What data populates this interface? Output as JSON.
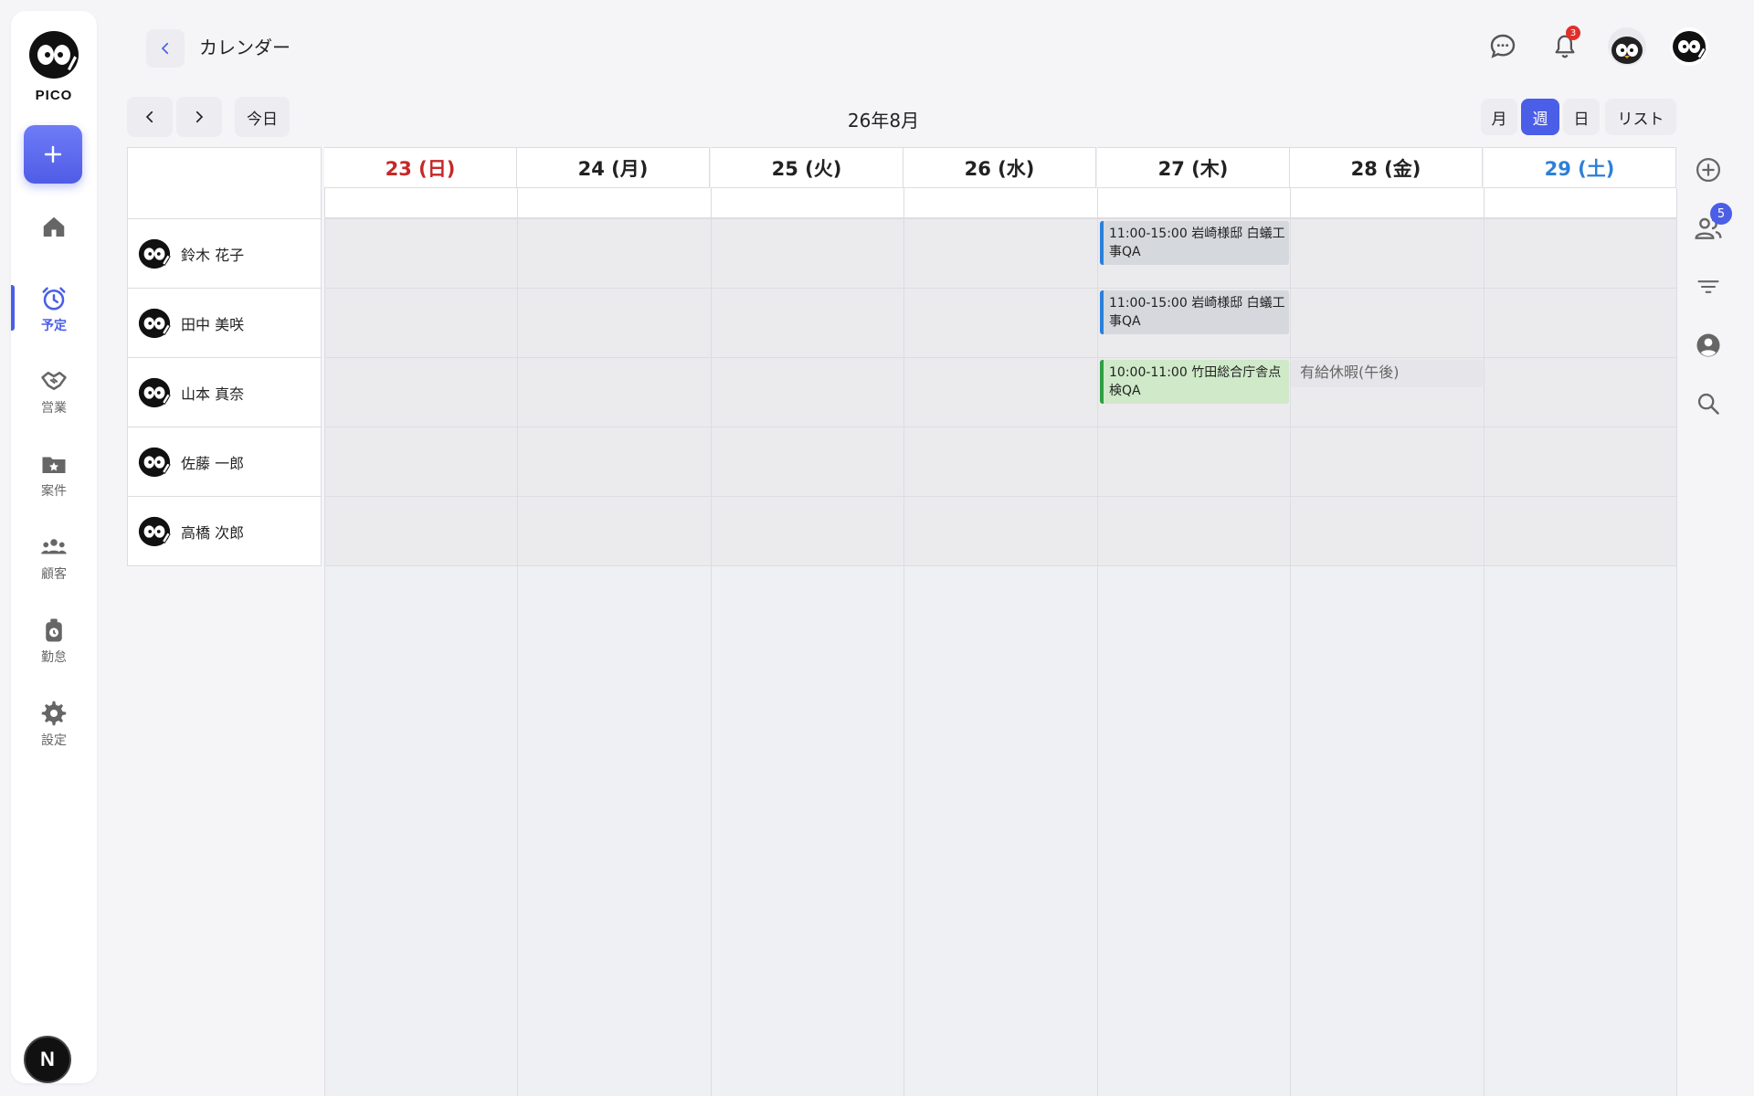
{
  "app": {
    "logo_text": "PICO"
  },
  "header": {
    "title": "カレンダー",
    "notification_count": "3"
  },
  "sidebar": {
    "items": [
      {
        "id": "home",
        "label": "",
        "icon": "home-icon"
      },
      {
        "id": "schedule",
        "label": "予定",
        "icon": "alarm-clock-icon",
        "active": true
      },
      {
        "id": "sales",
        "label": "営業",
        "icon": "handshake-icon"
      },
      {
        "id": "projects",
        "label": "案件",
        "icon": "folder-star-icon"
      },
      {
        "id": "customers",
        "label": "顧客",
        "icon": "group-icon"
      },
      {
        "id": "attendance",
        "label": "勤怠",
        "icon": "badge-clock-icon"
      },
      {
        "id": "settings",
        "label": "設定",
        "icon": "gear-icon"
      }
    ],
    "bottom_badge": "N"
  },
  "toolbar": {
    "today_label": "今日",
    "month_label": "26年8月",
    "views": [
      {
        "id": "month",
        "label": "月"
      },
      {
        "id": "week",
        "label": "週",
        "active": true
      },
      {
        "id": "day",
        "label": "日"
      },
      {
        "id": "list",
        "label": "リスト"
      }
    ]
  },
  "right_rail": {
    "people_badge": "5"
  },
  "calendar": {
    "days": [
      {
        "label": "23 (日)",
        "kind": "sun"
      },
      {
        "label": "24 (月)",
        "kind": "weekday"
      },
      {
        "label": "25 (火)",
        "kind": "weekday"
      },
      {
        "label": "26 (水)",
        "kind": "weekday"
      },
      {
        "label": "27 (木)",
        "kind": "weekday"
      },
      {
        "label": "28 (金)",
        "kind": "weekday"
      },
      {
        "label": "29 (土)",
        "kind": "sat"
      }
    ],
    "people": [
      {
        "name": "鈴木 花子"
      },
      {
        "name": "田中 美咲"
      },
      {
        "name": "山本 真奈"
      },
      {
        "name": "佐藤 一郎"
      },
      {
        "name": "高橋 次郎"
      }
    ],
    "events": [
      {
        "person": 0,
        "day": 4,
        "text": "11:00-15:00 岩崎様邸 白蟻工事QA",
        "color": "blue"
      },
      {
        "person": 1,
        "day": 4,
        "text": "11:00-15:00 岩崎様邸 白蟻工事QA",
        "color": "blue"
      },
      {
        "person": 2,
        "day": 4,
        "text": "10:00-11:00 竹田総合庁舎点検QA",
        "color": "green"
      },
      {
        "person": 2,
        "day": 5,
        "text": "有給休暇(午後)",
        "color": "leave"
      }
    ]
  },
  "colors": {
    "accent": "#4a5ee8",
    "sunday": "#c62828",
    "saturday": "#2e7fd6"
  }
}
